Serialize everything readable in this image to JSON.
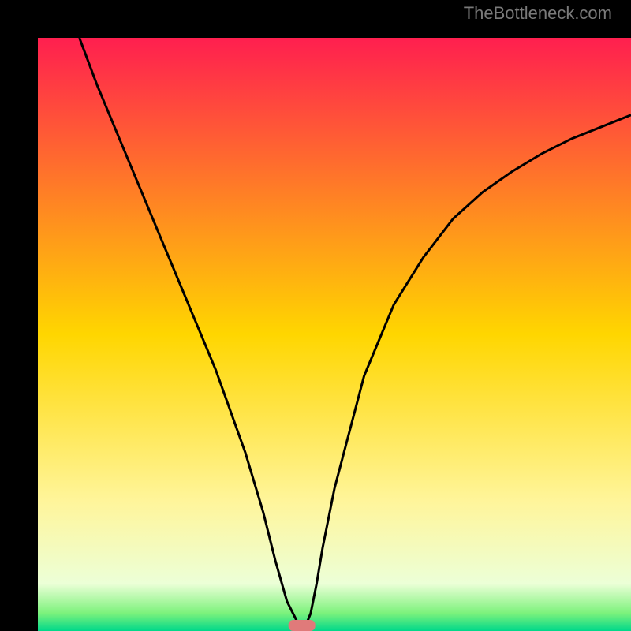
{
  "watermark": "TheBottleneck.com",
  "chart_data": {
    "type": "line",
    "title": "",
    "xlabel": "",
    "ylabel": "",
    "xlim": [
      0,
      100
    ],
    "ylim": [
      0,
      100
    ],
    "background": {
      "type": "vertical-gradient",
      "stops": [
        {
          "offset": 0,
          "color": "#ff1f4f"
        },
        {
          "offset": 50,
          "color": "#ffd600"
        },
        {
          "offset": 78,
          "color": "#fff59a"
        },
        {
          "offset": 92,
          "color": "#ecffd7"
        },
        {
          "offset": 97,
          "color": "#7cf27c"
        },
        {
          "offset": 100,
          "color": "#00d88a"
        }
      ]
    },
    "series": [
      {
        "name": "curve",
        "x": [
          7,
          10,
          15,
          20,
          25,
          30,
          35,
          38,
          40,
          42,
          44,
          44.5,
          45,
          46,
          47,
          48,
          50,
          55,
          60,
          65,
          70,
          75,
          80,
          85,
          90,
          95,
          100
        ],
        "y": [
          100,
          92,
          80,
          68,
          56,
          44,
          30,
          20,
          12,
          5,
          1,
          0,
          0.5,
          3,
          8,
          14,
          24,
          43,
          55,
          63,
          69.5,
          74,
          77.5,
          80.5,
          83,
          85,
          87
        ]
      }
    ],
    "marker": {
      "x": 44.5,
      "y": 0,
      "color": "#e07a7a"
    },
    "colors": {
      "frame": "#000000",
      "curve": "#000000"
    }
  }
}
